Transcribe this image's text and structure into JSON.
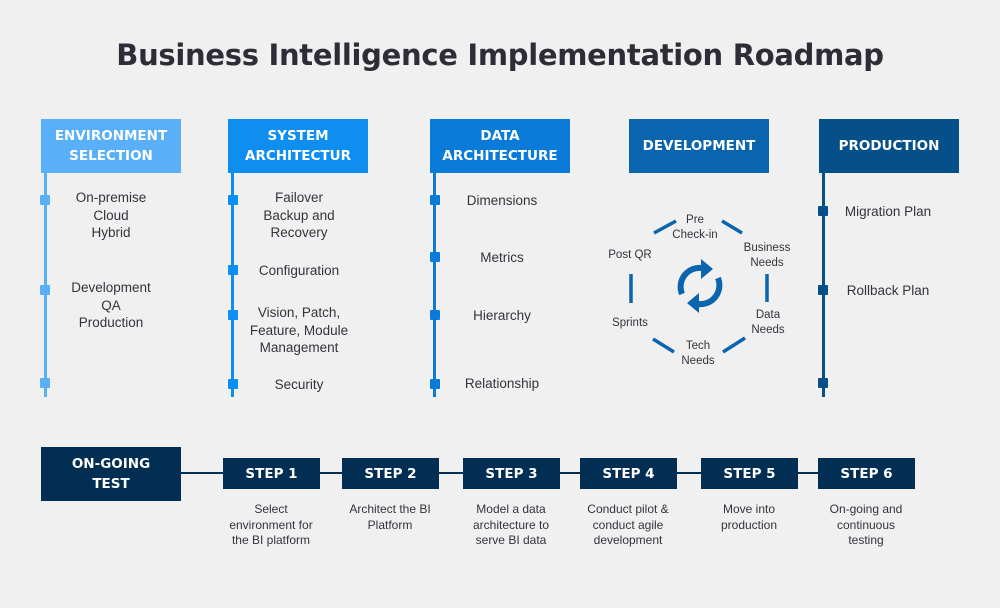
{
  "title": "Business Intelligence Implementation Roadmap",
  "colors": {
    "environment": "#5ab0f8",
    "system": "#0e8ef0",
    "data": "#0a7bd8",
    "development": "#0b64ae",
    "production": "#06508a",
    "steps": "#022e54",
    "text": "#33333d"
  },
  "phases": [
    {
      "label_line1": "ENVIRONMENT",
      "label_line2": "SELECTION",
      "items": [
        "On-premise\nCloud\nHybrid",
        "Development\nQA\nProduction"
      ]
    },
    {
      "label_line1": "SYSTEM",
      "label_line2": "ARCHITECTUR",
      "items": [
        "Failover\nBackup and\nRecovery",
        "Configuration",
        "Vision, Patch,\nFeature, Module\nManagement",
        "Security"
      ]
    },
    {
      "label_line1": "DATA",
      "label_line2": "ARCHITECTURE",
      "items": [
        "Dimensions",
        "Metrics",
        "Hierarchy",
        "Relationship"
      ]
    },
    {
      "label_line1": "DEVELOPMENT",
      "label_line2": "",
      "cycle": [
        "Pre\nCheck-in",
        "Business\nNeeds",
        "Data\nNeeds",
        "Tech\nNeeds",
        "Sprints",
        "Post QR"
      ],
      "cycle_icon": "refresh-cycle-icon"
    },
    {
      "label_line1": "PRODUCTION",
      "label_line2": "",
      "items": [
        "Migration Plan",
        "Rollback Plan"
      ]
    }
  ],
  "ongoing": {
    "line1": "ON-GOING",
    "line2": "TEST"
  },
  "steps": [
    {
      "label": "STEP 1",
      "desc": "Select\nenvironment for\nthe BI platform"
    },
    {
      "label": "STEP 2",
      "desc": "Architect the BI\nPlatform"
    },
    {
      "label": "STEP 3",
      "desc": "Model a data\narchitecture to\nserve BI data"
    },
    {
      "label": "STEP 4",
      "desc": "Conduct pilot &\nconduct agile\ndevelopment"
    },
    {
      "label": "STEP 5",
      "desc": "Move into\nproduction"
    },
    {
      "label": "STEP 6",
      "desc": "On-going and\ncontinuous\ntesting"
    }
  ]
}
